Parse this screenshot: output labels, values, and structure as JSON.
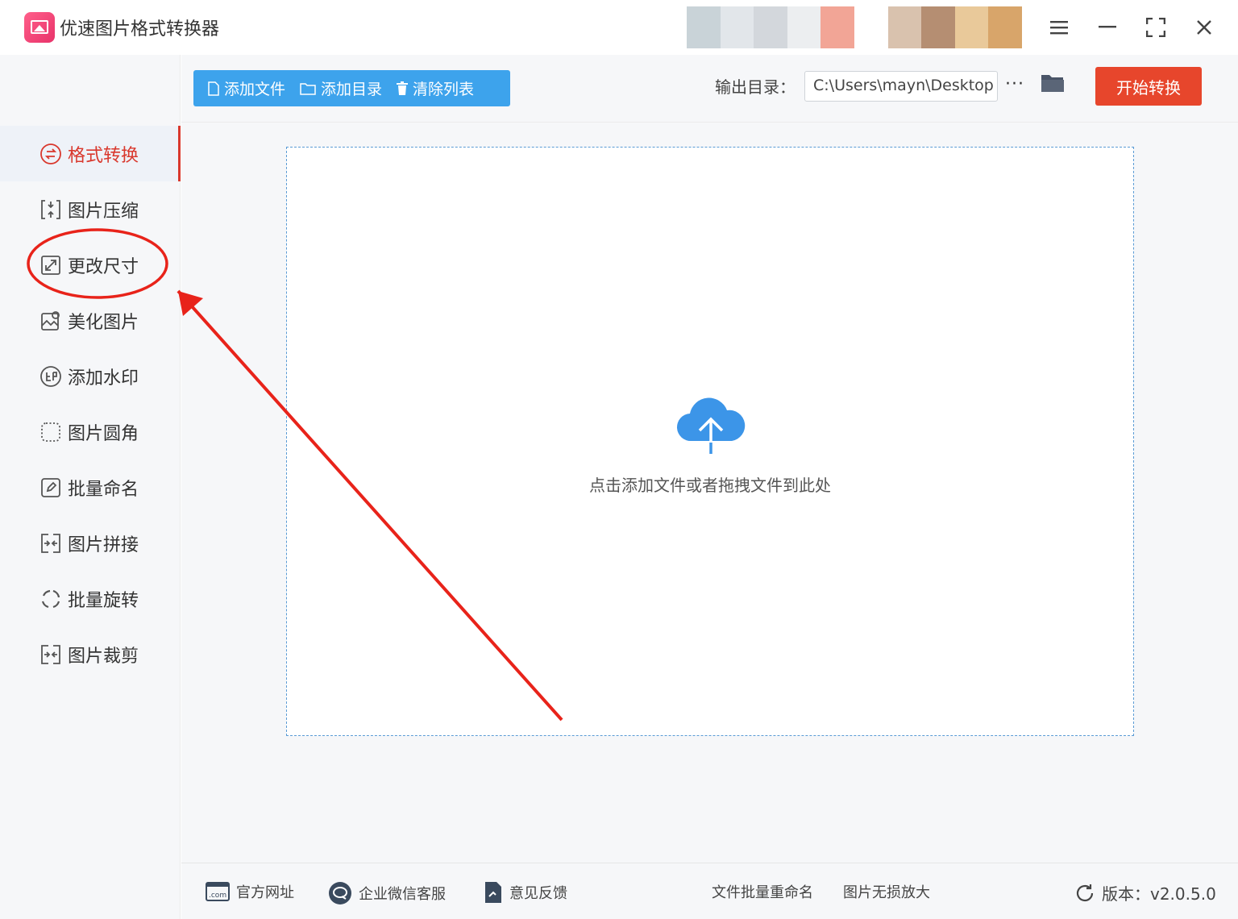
{
  "app": {
    "title": "优速图片格式转换器"
  },
  "window_controls": [
    "menu-icon",
    "minimize-icon",
    "maximize-icon",
    "close-icon"
  ],
  "sidebar": {
    "items": [
      {
        "label": "格式转换",
        "icon": "format-convert-icon",
        "active": true
      },
      {
        "label": "图片压缩",
        "icon": "compress-icon"
      },
      {
        "label": "更改尺寸",
        "icon": "resize-icon"
      },
      {
        "label": "美化图片",
        "icon": "beautify-icon"
      },
      {
        "label": "添加水印",
        "icon": "watermark-icon"
      },
      {
        "label": "图片圆角",
        "icon": "rounded-corner-icon"
      },
      {
        "label": "批量命名",
        "icon": "rename-icon"
      },
      {
        "label": "图片拼接",
        "icon": "stitch-icon"
      },
      {
        "label": "批量旋转",
        "icon": "rotate-icon"
      },
      {
        "label": "图片裁剪",
        "icon": "crop-icon"
      }
    ]
  },
  "toolbar": {
    "add_file": "添加文件",
    "add_folder": "添加目录",
    "clear_list": "清除列表",
    "output_label": "输出目录：",
    "output_path": "C:\\Users\\mayn\\Desktop",
    "more": "···",
    "start": "开始转换"
  },
  "dropzone": {
    "hint": "点击添加文件或者拖拽文件到此处"
  },
  "footer": {
    "website": "官方网址",
    "wechat_service": "企业微信客服",
    "feedback": "意见反馈",
    "batch_rename": "文件批量重命名",
    "lossless_enlarge": "图片无损放大",
    "version": "版本：v2.0.5.0"
  },
  "colors": {
    "accent_blue": "#3da3ec",
    "start_red": "#e7462c",
    "active_red": "#d9382d",
    "annotation_red": "#e8231a"
  }
}
